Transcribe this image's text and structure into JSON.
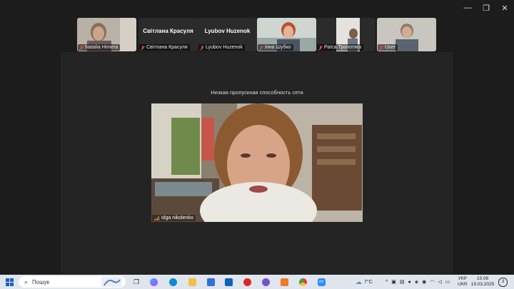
{
  "window": {
    "min": "—",
    "restore": "❐",
    "close": "✕"
  },
  "participants": [
    {
      "display": "video",
      "label": "Natalia Himera"
    },
    {
      "display": "name",
      "name": "Світлана Красуля",
      "label": "Світлана Красуля"
    },
    {
      "display": "name",
      "name": "Lyubov Huzenok",
      "label": "Lyubov Huzenok"
    },
    {
      "display": "video",
      "label": "Інна Шубко"
    },
    {
      "display": "video",
      "label": "Раїса Тропотяга"
    },
    {
      "display": "video",
      "label": "User"
    }
  ],
  "network_warning": "Низкая пропускная способность сети",
  "main_speaker": {
    "label": "olga nikolenko"
  },
  "taskbar": {
    "search_placeholder": "Пошук",
    "weather": "7°C",
    "lang_top": "УКР",
    "lang_bottom": "UKR",
    "time": "15:08",
    "date": "19.03.2025",
    "notifications": "3"
  },
  "colors": {
    "tile_bg": "#2b2b2b",
    "stage_bg": "#242424",
    "taskbar_bg": "#dfe6ee",
    "muted_red": "#e04848"
  }
}
